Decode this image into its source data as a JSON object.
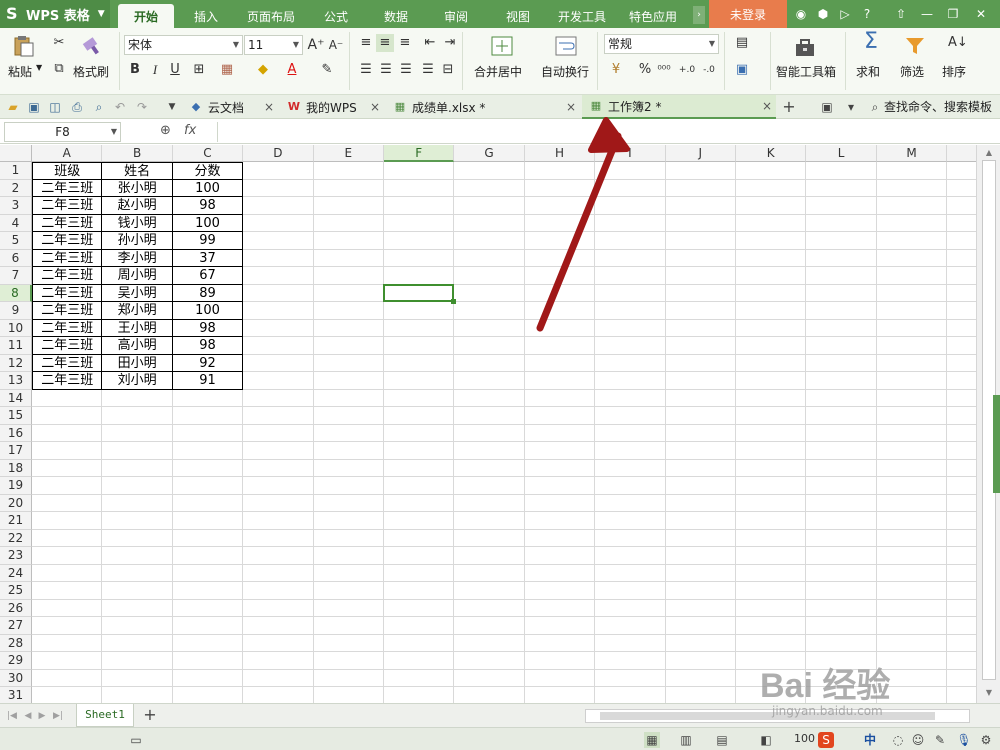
{
  "app": {
    "name": "WPS 表格"
  },
  "menu": {
    "tabs": [
      "开始",
      "插入",
      "页面布局",
      "公式",
      "数据",
      "审阅",
      "视图",
      "开发工具",
      "特色应用"
    ],
    "active": 0,
    "login": "未登录"
  },
  "ribbon": {
    "paste": "粘贴",
    "format_painter": "格式刷",
    "font_name": "宋体",
    "font_size": "11",
    "merge_center": "合并居中",
    "wrap_text": "自动换行",
    "number_format": "常规",
    "smart_toolbox": "智能工具箱",
    "sum": "求和",
    "filter": "筛选",
    "sort": "排序"
  },
  "doc_tabs": [
    {
      "label": "云文档",
      "icon": "cloud-doc-icon",
      "active": false
    },
    {
      "label": "我的WPS",
      "icon": "wps-logo-icon",
      "active": false
    },
    {
      "label": "成绩单.xlsx *",
      "icon": "spreadsheet-icon",
      "active": false
    },
    {
      "label": "工作簿2 *",
      "icon": "spreadsheet-icon",
      "active": true
    }
  ],
  "search": {
    "placeholder": "查找命令、搜索模板"
  },
  "formula_bar": {
    "name_box": "F8",
    "fx": "fx",
    "value": ""
  },
  "grid": {
    "columns": [
      "A",
      "B",
      "C",
      "D",
      "E",
      "F",
      "G",
      "H",
      "I",
      "J",
      "K",
      "L",
      "M"
    ],
    "selected_column": "F",
    "selected_row": 8,
    "row_count": 31,
    "rows": [
      [
        "班级",
        "姓名",
        "分数"
      ],
      [
        "二年三班",
        "张小明",
        "100"
      ],
      [
        "二年三班",
        "赵小明",
        "98"
      ],
      [
        "二年三班",
        "钱小明",
        "100"
      ],
      [
        "二年三班",
        "孙小明",
        "99"
      ],
      [
        "二年三班",
        "李小明",
        "37"
      ],
      [
        "二年三班",
        "周小明",
        "67"
      ],
      [
        "二年三班",
        "吴小明",
        "89"
      ],
      [
        "二年三班",
        "郑小明",
        "100"
      ],
      [
        "二年三班",
        "王小明",
        "98"
      ],
      [
        "二年三班",
        "高小明",
        "98"
      ],
      [
        "二年三班",
        "田小明",
        "92"
      ],
      [
        "二年三班",
        "刘小明",
        "91"
      ]
    ]
  },
  "sheets": [
    "Sheet1"
  ],
  "status": {
    "zoom": "100"
  },
  "watermark": {
    "main": "Bai 经验",
    "sub": "jingyan.baidu.com"
  },
  "colors": {
    "accent": "#5b9b52",
    "login": "#e87c4c",
    "arrow": "#a01818"
  }
}
